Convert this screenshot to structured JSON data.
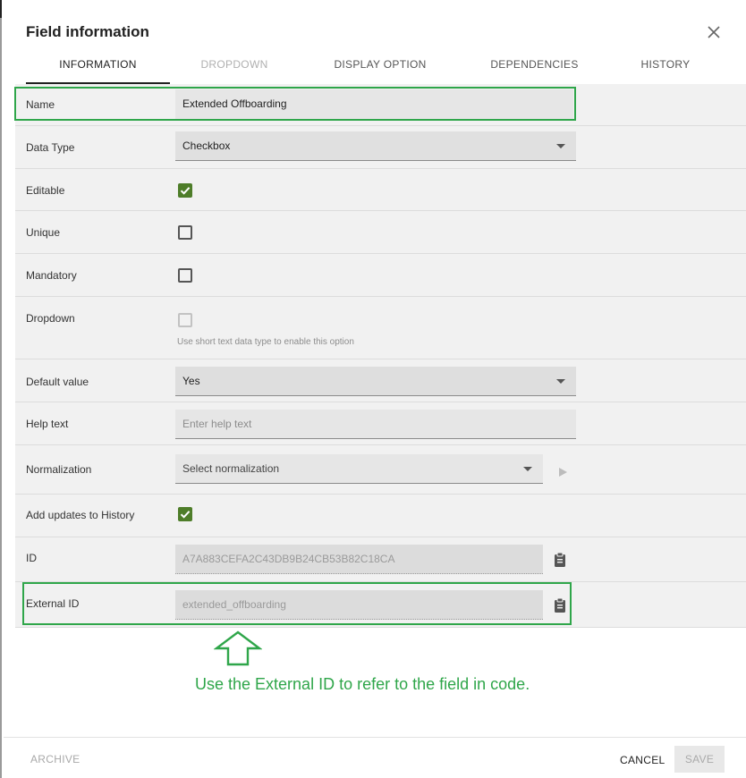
{
  "dialog": {
    "title": "Field information",
    "close_icon": "close-icon"
  },
  "tabs": [
    {
      "label": "INFORMATION",
      "state": "active"
    },
    {
      "label": "DROPDOWN",
      "state": "disabled"
    },
    {
      "label": "DISPLAY OPTION",
      "state": "normal"
    },
    {
      "label": "DEPENDENCIES",
      "state": "normal"
    },
    {
      "label": "HISTORY",
      "state": "normal"
    }
  ],
  "form": {
    "name": {
      "label": "Name",
      "value": "Extended Offboarding"
    },
    "data_type": {
      "label": "Data Type",
      "value": "Checkbox"
    },
    "editable": {
      "label": "Editable",
      "checked": true
    },
    "unique": {
      "label": "Unique",
      "checked": false
    },
    "mandatory": {
      "label": "Mandatory",
      "checked": false
    },
    "dropdown": {
      "label": "Dropdown",
      "checked": false,
      "disabled": true,
      "hint": "Use short text data type to enable this option"
    },
    "default_value": {
      "label": "Default value",
      "value": "Yes"
    },
    "help_text": {
      "label": "Help text",
      "placeholder": "Enter help text"
    },
    "normalization": {
      "label": "Normalization",
      "placeholder": "Select normalization"
    },
    "add_updates": {
      "label": "Add updates to History",
      "checked": true
    },
    "id": {
      "label": "ID",
      "value": "A7A883CEFA2C43DB9B24CB53B82C18CA"
    },
    "external_id": {
      "label": "External ID",
      "value": "extended_offboarding"
    }
  },
  "annotation": {
    "text": "Use the External ID to refer to the field in code.",
    "color": "#2fa64a"
  },
  "footer": {
    "archive_label": "ARCHIVE",
    "cancel_label": "CANCEL",
    "save_label": "SAVE"
  },
  "colors": {
    "checkbox_checked": "#4e7d29",
    "highlight": "#2fa64a"
  }
}
